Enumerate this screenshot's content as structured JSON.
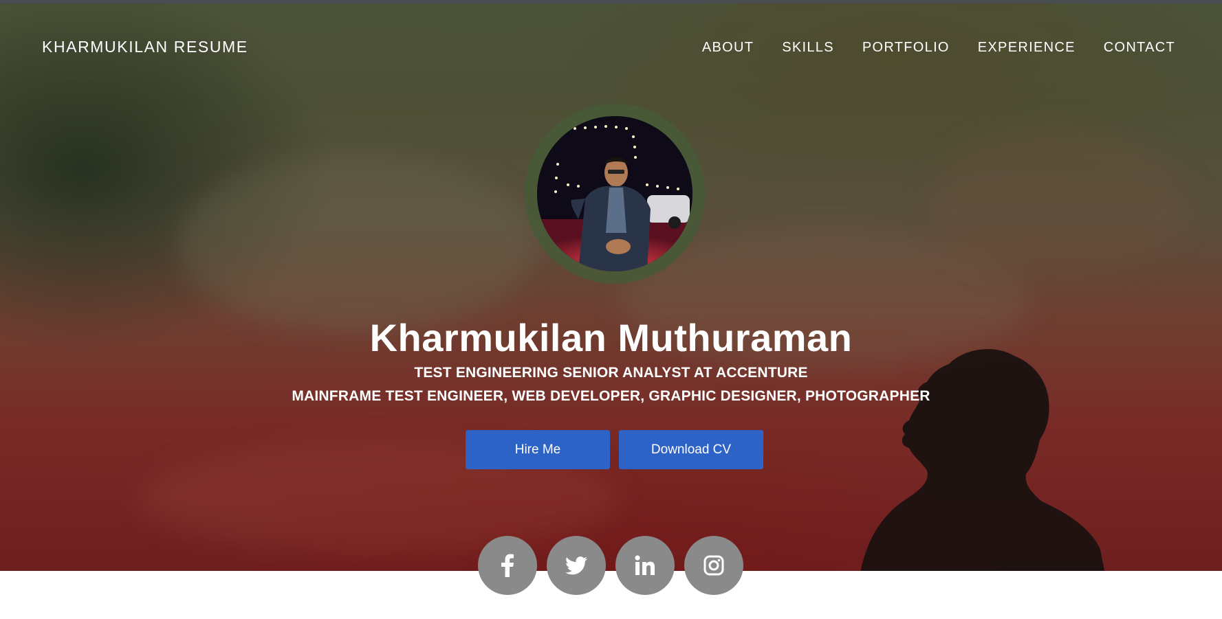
{
  "brand": {
    "title": "KHARMUKILAN RESUME"
  },
  "nav": {
    "items": [
      {
        "label": "ABOUT"
      },
      {
        "label": "SKILLS"
      },
      {
        "label": "PORTFOLIO"
      },
      {
        "label": "EXPERIENCE"
      },
      {
        "label": "CONTACT"
      }
    ]
  },
  "hero": {
    "name": "Kharmukilan Muthuraman",
    "subtitle_1": "TEST ENGINEERING SENIOR ANALYST AT ACCENTURE",
    "subtitle_2": "MAINFRAME TEST ENGINEER, WEB DEVELOPER, GRAPHIC DESIGNER, PHOTOGRAPHER",
    "hire_button": "Hire Me",
    "download_button": "Download CV"
  },
  "social": [
    {
      "icon": "facebook-icon"
    },
    {
      "icon": "twitter-icon"
    },
    {
      "icon": "linkedin-icon"
    },
    {
      "icon": "instagram-icon"
    }
  ],
  "colors": {
    "button": "#2d62c6",
    "social_circle": "#8a8a8a",
    "text": "#ffffff"
  }
}
